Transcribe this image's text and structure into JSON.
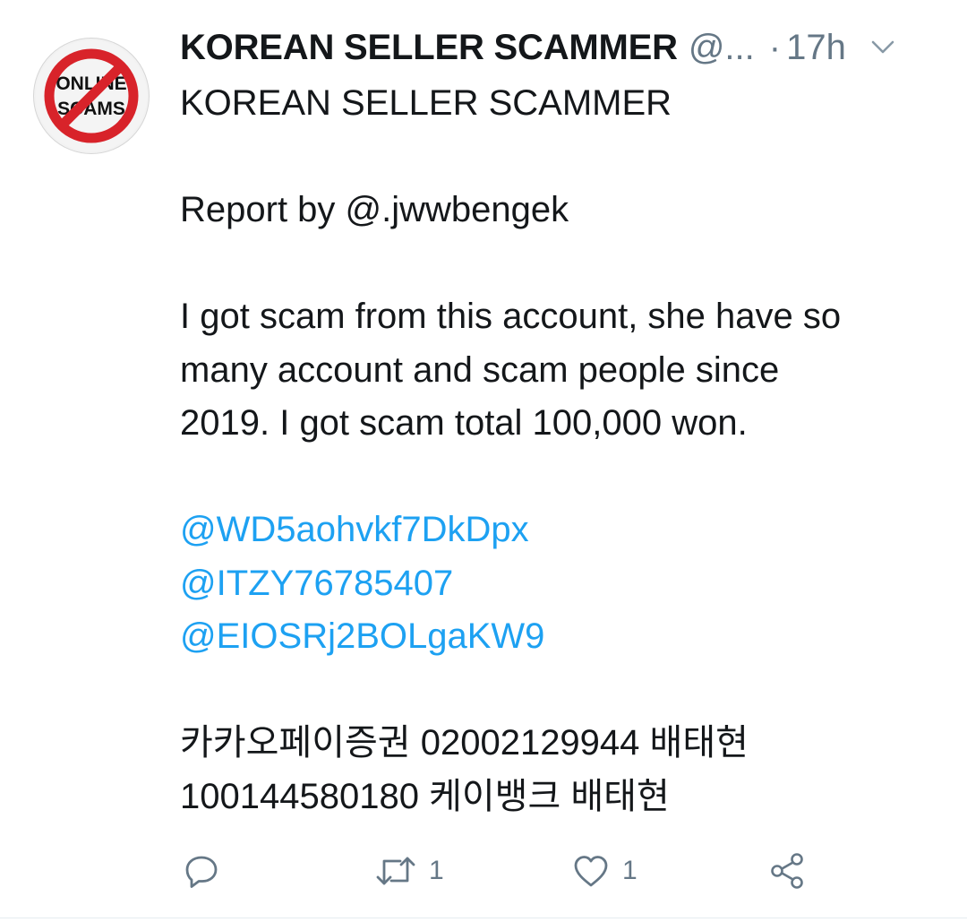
{
  "tweet": {
    "author": {
      "display_name": "KOREAN SELLER SCAMMER",
      "handle": "@...",
      "avatar": {
        "icon": "no-online-scams-icon",
        "line1": "ONLINE",
        "line2": "SCAMS"
      }
    },
    "separator": "·",
    "timestamp": "17h",
    "lines": [
      {
        "text": "KOREAN SELLER SCAMMER",
        "kind": "text"
      },
      {
        "text": "",
        "kind": "blank"
      },
      {
        "text": "Report by @.jwwbengek",
        "kind": "text"
      },
      {
        "text": "",
        "kind": "blank"
      },
      {
        "text": "I got scam from this account, she have so",
        "kind": "text"
      },
      {
        "text": "many account and scam people since",
        "kind": "text"
      },
      {
        "text": "2019. I got scam total 100,000 won.",
        "kind": "text"
      },
      {
        "text": "",
        "kind": "blank"
      },
      {
        "text": "@WD5aohvkf7DkDpx",
        "kind": "mention"
      },
      {
        "text": "@ITZY76785407",
        "kind": "mention"
      },
      {
        "text": "@EIOSRj2BOLgaKW9",
        "kind": "mention"
      },
      {
        "text": "",
        "kind": "blank"
      },
      {
        "text": "카카오페이증권 02002129944 배태현",
        "kind": "text"
      },
      {
        "text": "100144580180 케이뱅크 배태현",
        "kind": "text"
      }
    ],
    "actions": {
      "reply": {
        "icon": "reply-icon",
        "count": ""
      },
      "retweet": {
        "icon": "retweet-icon",
        "count": "1"
      },
      "like": {
        "icon": "heart-icon",
        "count": "1"
      },
      "share": {
        "icon": "share-icon"
      }
    }
  },
  "colors": {
    "text": "#14171a",
    "muted": "#657786",
    "link": "#1da1f2",
    "avatar_ring": "#d8232a"
  }
}
